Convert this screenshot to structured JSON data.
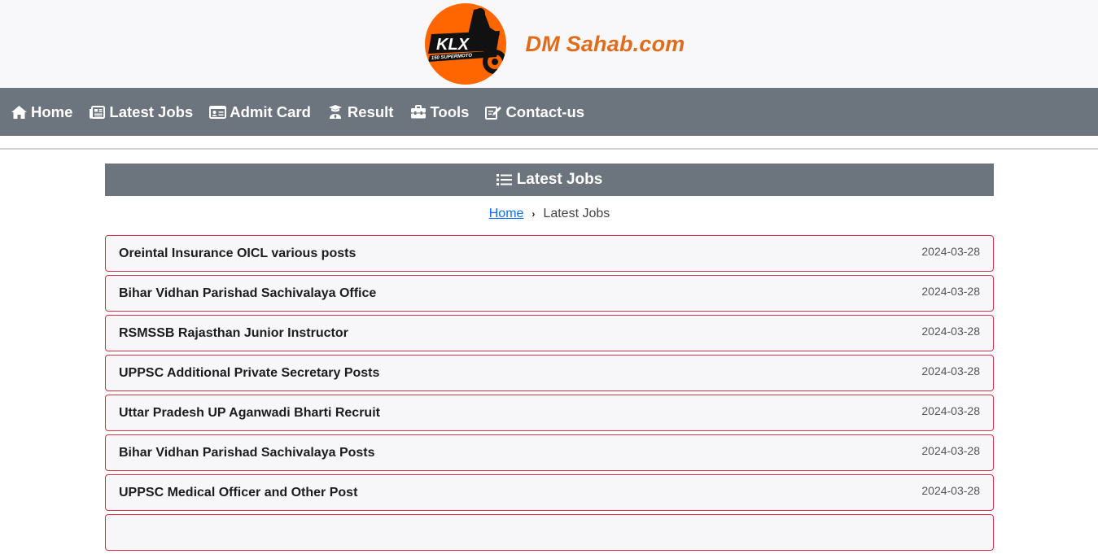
{
  "header": {
    "logo_text": "KLX",
    "logo_subtext": "150 SUPERMOTO",
    "site_name": "DM Sahab.com",
    "brand_color": "#e06c1a",
    "logo_bg": "#ff6600"
  },
  "nav": {
    "items": [
      {
        "label": "Home",
        "icon": "home-icon"
      },
      {
        "label": "Latest Jobs",
        "icon": "newspaper-icon"
      },
      {
        "label": "Admit Card",
        "icon": "id-card-icon"
      },
      {
        "label": "Result",
        "icon": "graduate-icon"
      },
      {
        "label": "Tools",
        "icon": "toolbox-icon"
      },
      {
        "label": "Contact-us",
        "icon": "edit-icon"
      }
    ]
  },
  "section": {
    "title": "Latest Jobs",
    "icon": "list-icon"
  },
  "breadcrumb": {
    "home": "Home",
    "current": "Latest Jobs"
  },
  "jobs": [
    {
      "title": "Oreintal Insurance OICL various posts",
      "date": "2024-03-28"
    },
    {
      "title": "Bihar Vidhan Parishad Sachivalaya Office",
      "date": "2024-03-28"
    },
    {
      "title": "RSMSSB Rajasthan Junior Instructor",
      "date": "2024-03-28"
    },
    {
      "title": "UPPSC Additional Private Secretary Posts",
      "date": "2024-03-28"
    },
    {
      "title": "Uttar Pradesh UP Aganwadi Bharti Recruit",
      "date": "2024-03-28"
    },
    {
      "title": "Bihar Vidhan Parishad Sachivalaya Posts",
      "date": "2024-03-28"
    },
    {
      "title": "UPPSC Medical Officer and Other Post",
      "date": "2024-03-28"
    }
  ],
  "colors": {
    "nav_bg": "#6c757d",
    "card_border": "#d2344a",
    "link": "#0d6efd"
  }
}
